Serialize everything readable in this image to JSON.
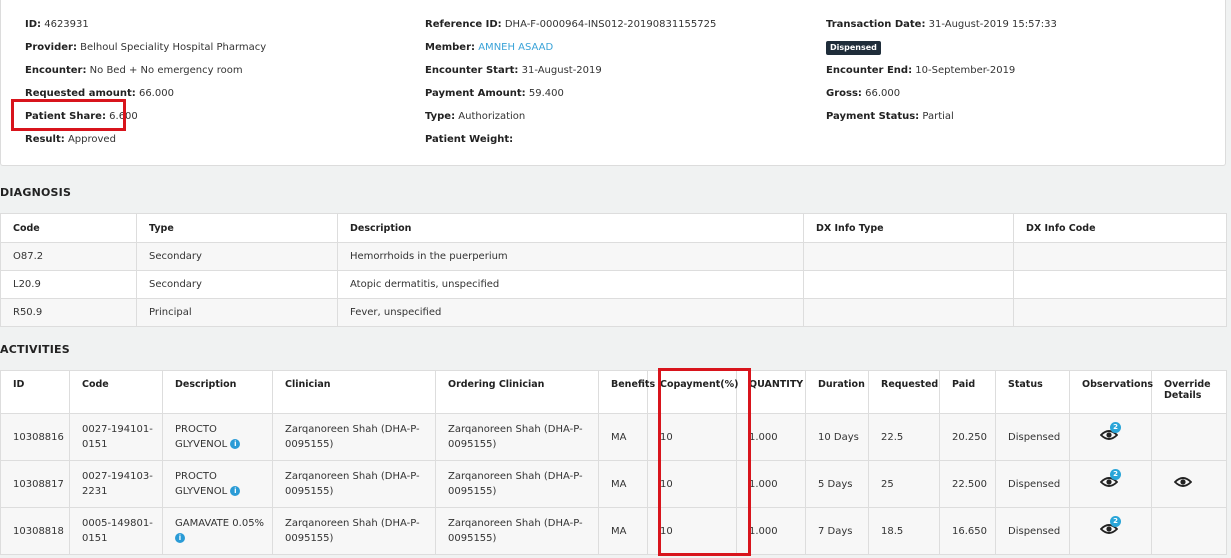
{
  "summary": {
    "id_label": "ID:",
    "id_value": "4623931",
    "provider_label": "Provider:",
    "provider_value": "Belhoul Speciality Hospital Pharmacy",
    "encounter_label": "Encounter:",
    "encounter_value": "No Bed + No emergency room",
    "requested_label": "Requested amount:",
    "requested_value": "66.000",
    "patient_share_label": "Patient Share:",
    "patient_share_value": "6.600",
    "result_label": "Result:",
    "result_value": "Approved",
    "reference_label": "Reference ID:",
    "reference_value": "DHA-F-0000964-INS012-20190831155725",
    "member_label": "Member:",
    "member_value": "AMNEH ASAAD",
    "encounter_start_label": "Encounter Start:",
    "encounter_start_value": "31-August-2019",
    "payment_amount_label": "Payment Amount:",
    "payment_amount_value": "59.400",
    "type_label": "Type:",
    "type_value": "Authorization",
    "patient_weight_label": "Patient Weight:",
    "patient_weight_value": "",
    "transaction_date_label": "Transaction Date:",
    "transaction_date_value": "31-August-2019 15:57:33",
    "status_badge": "Dispensed",
    "encounter_end_label": "Encounter End:",
    "encounter_end_value": "10-September-2019",
    "gross_label": "Gross:",
    "gross_value": "66.000",
    "payment_status_label": "Payment Status:",
    "payment_status_value": "Partial"
  },
  "diagnosis": {
    "title": "DIAGNOSIS",
    "headers": [
      "Code",
      "Type",
      "Description",
      "DX Info Type",
      "DX Info Code"
    ],
    "rows": [
      [
        "O87.2",
        "Secondary",
        "Hemorrhoids in the puerperium",
        "",
        ""
      ],
      [
        "L20.9",
        "Secondary",
        "Atopic dermatitis, unspecified",
        "",
        ""
      ],
      [
        "R50.9",
        "Principal",
        "Fever, unspecified",
        "",
        ""
      ]
    ]
  },
  "activities": {
    "title": "ACTIVITIES",
    "headers": [
      "ID",
      "Code",
      "Description",
      "Clinician",
      "Ordering Clinician",
      "Benefits",
      "Copayment(%)",
      "QUANTITY",
      "Duration",
      "Requested",
      "Paid",
      "Status",
      "Observations",
      "Override Details"
    ],
    "rows": [
      {
        "id": "10308816",
        "code": "0027-194101-0151",
        "description": "PROCTO GLYVENOL",
        "clinician": "Zarqanoreen Shah (DHA-P-0095155)",
        "ordering": "Zarqanoreen Shah (DHA-P-0095155)",
        "benefits": "MA",
        "copayment": "10",
        "quantity": "1.000",
        "duration": "10 Days",
        "requested": "22.5",
        "paid": "20.250",
        "status": "Dispensed",
        "observations_count": "2",
        "has_override": false
      },
      {
        "id": "10308817",
        "code": "0027-194103-2231",
        "description": "PROCTO GLYVENOL",
        "clinician": "Zarqanoreen Shah (DHA-P-0095155)",
        "ordering": "Zarqanoreen Shah (DHA-P-0095155)",
        "benefits": "MA",
        "copayment": "10",
        "quantity": "1.000",
        "duration": "5 Days",
        "requested": "25",
        "paid": "22.500",
        "status": "Dispensed",
        "observations_count": "2",
        "has_override": true
      },
      {
        "id": "10308818",
        "code": "0005-149801-0151",
        "description": "GAMAVATE 0.05%",
        "clinician": "Zarqanoreen Shah (DHA-P-0095155)",
        "ordering": "Zarqanoreen Shah (DHA-P-0095155)",
        "benefits": "MA",
        "copayment": "10",
        "quantity": "1.000",
        "duration": "7 Days",
        "requested": "18.5",
        "paid": "16.650",
        "status": "Dispensed",
        "observations_count": "2",
        "has_override": false
      }
    ]
  },
  "icons": {
    "info": "info-icon",
    "info_glyph": "i",
    "eye": "eye-icon"
  },
  "colors": {
    "highlight_red": "#d8141c",
    "link_blue": "#3aa3d8",
    "badge_dark": "#1f2d3a"
  }
}
